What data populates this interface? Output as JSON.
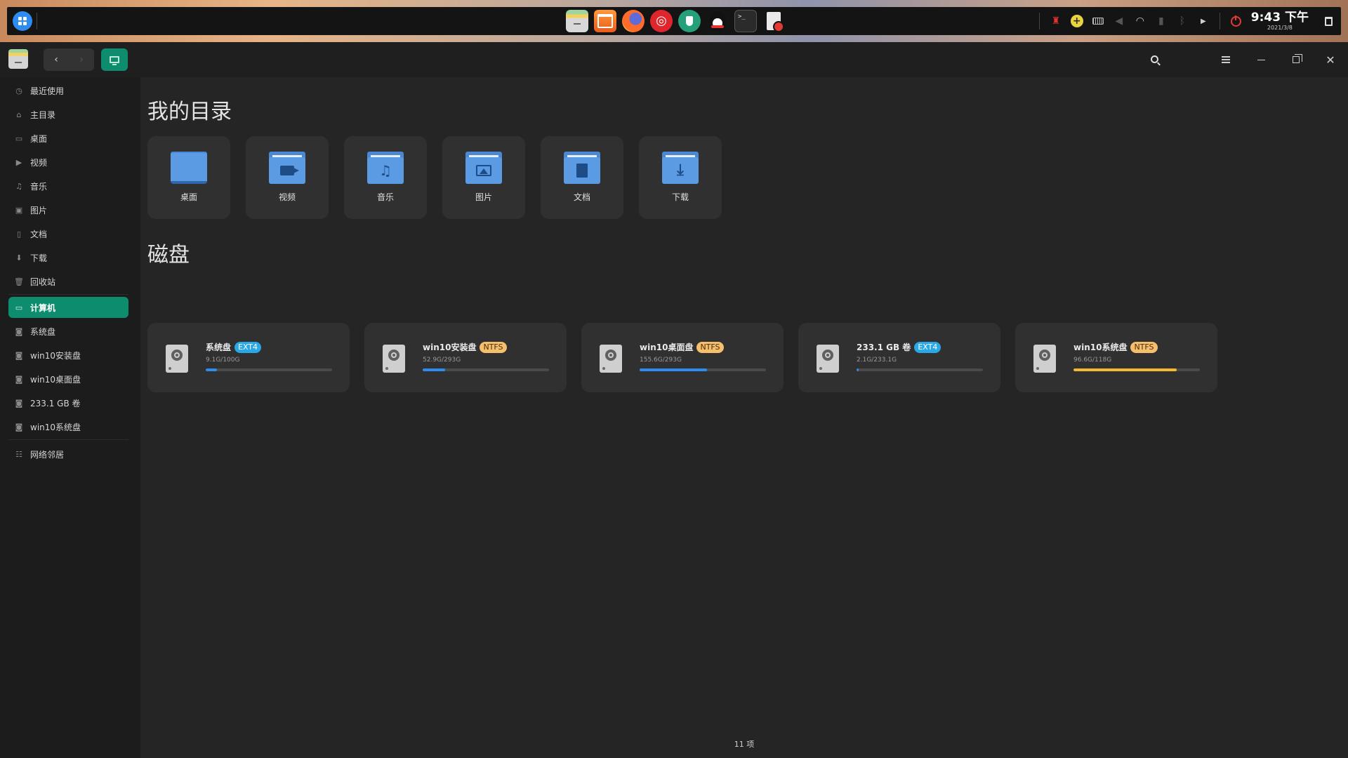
{
  "dock": {
    "apps": [
      {
        "name": "file-manager"
      },
      {
        "name": "app-store"
      },
      {
        "name": "firefox"
      },
      {
        "name": "netease-music"
      },
      {
        "name": "dev-tool"
      },
      {
        "name": "qq"
      },
      {
        "name": "terminal"
      },
      {
        "name": "document-editor"
      }
    ],
    "clock_time": "9:43 下午",
    "clock_date": "2021/3/8"
  },
  "toolbar": {
    "back_icon": "‹",
    "forward_icon": "›",
    "current_location_icon": "computer-icon"
  },
  "sidebar": {
    "items": [
      {
        "label": "最近使用",
        "icon": "clock-icon"
      },
      {
        "label": "主目录",
        "icon": "home-icon"
      },
      {
        "label": "桌面",
        "icon": "desktop-icon"
      },
      {
        "label": "视频",
        "icon": "video-icon"
      },
      {
        "label": "音乐",
        "icon": "music-icon"
      },
      {
        "label": "图片",
        "icon": "picture-icon"
      },
      {
        "label": "文档",
        "icon": "document-icon"
      },
      {
        "label": "下载",
        "icon": "download-icon"
      },
      {
        "label": "回收站",
        "icon": "trash-icon"
      },
      {
        "label": "计算机",
        "icon": "computer-icon",
        "active": true
      },
      {
        "label": "系统盘",
        "icon": "drive-icon"
      },
      {
        "label": "win10安装盘",
        "icon": "drive-icon"
      },
      {
        "label": "win10桌面盘",
        "icon": "drive-icon"
      },
      {
        "label": "233.1 GB 卷",
        "icon": "drive-icon"
      },
      {
        "label": "win10系统盘",
        "icon": "drive-icon"
      },
      {
        "label": "网络邻居",
        "icon": "network-icon"
      }
    ]
  },
  "main": {
    "my_dirs_title": "我的目录",
    "dirs": [
      {
        "label": "桌面"
      },
      {
        "label": "视频"
      },
      {
        "label": "音乐"
      },
      {
        "label": "图片"
      },
      {
        "label": "文档"
      },
      {
        "label": "下载"
      }
    ],
    "disks_title": "磁盘",
    "disks": [
      {
        "name": "系统盘",
        "fs": "EXT4",
        "usage": "9.1G/100G",
        "used_fraction": 0.091,
        "bar_color": "#2d8cf0"
      },
      {
        "name": "win10安装盘",
        "fs": "NTFS",
        "usage": "52.9G/293G",
        "used_fraction": 0.18,
        "bar_color": "#2d8cf0"
      },
      {
        "name": "win10桌面盘",
        "fs": "NTFS",
        "usage": "155.6G/293G",
        "used_fraction": 0.531,
        "bar_color": "#2d8cf0"
      },
      {
        "name": "233.1 GB 卷",
        "fs": "EXT4",
        "usage": "2.1G/233.1G",
        "used_fraction": 0.009,
        "bar_color": "#2d8cf0"
      },
      {
        "name": "win10系统盘",
        "fs": "NTFS",
        "usage": "96.6G/118G",
        "used_fraction": 0.819,
        "bar_color": "#f7b731"
      }
    ],
    "status": "11 项"
  }
}
